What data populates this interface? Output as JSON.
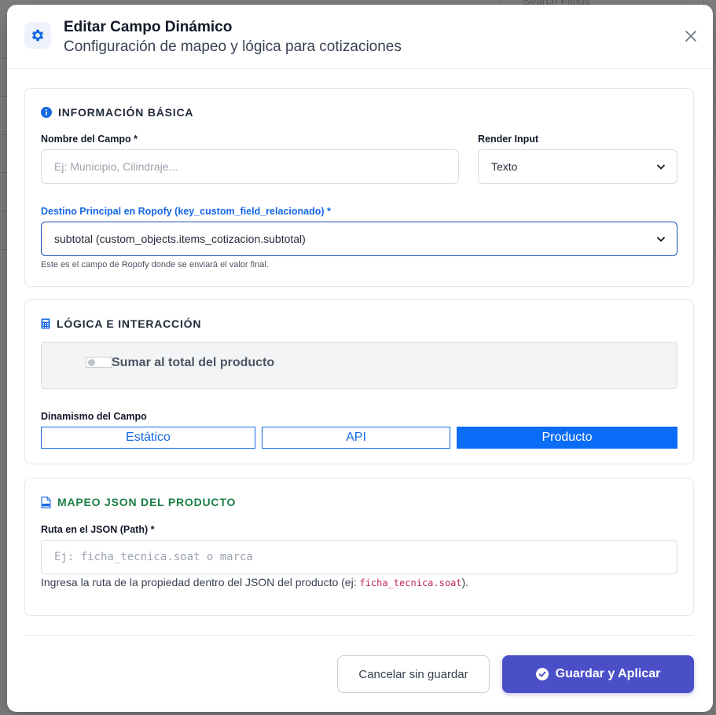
{
  "background": {
    "search_placeholder": "Search Fields"
  },
  "modal": {
    "title": "Editar Campo Dinámico",
    "subtitle": "Configuración de mapeo y lógica para cotizaciones",
    "header_icon": "gear-icon",
    "close_icon": "close-icon"
  },
  "basic": {
    "title": "INFORMACIÓN BÁSICA",
    "name_label": "Nombre del Campo *",
    "name_placeholder": "Ej: Municipio, Cilindraje...",
    "render_label": "Render Input",
    "render_value": "Texto",
    "target_label": "Destino Principal en Ropofy (key_custom_field_relacionado) *",
    "target_value": "subtotal (custom_objects.items_cotizacion.subtotal)",
    "target_help": "Este es el campo de Ropofy donde se enviará el valor final."
  },
  "logic": {
    "title": "LÓGICA E INTERACCIÓN",
    "toggle_label": "Sumar al total del producto",
    "toggle_on": false,
    "dynamism_label": "Dinamismo del Campo",
    "options": [
      "Estático",
      "API",
      "Producto"
    ],
    "selected": "Producto"
  },
  "mapping": {
    "title": "MAPEO JSON DEL PRODUCTO",
    "path_label": "Ruta en el JSON (Path) *",
    "path_placeholder": "Ej: ficha_tecnica.soat o marca",
    "help_prefix": "Ingresa la ruta de la propiedad dentro del JSON del producto (ej: ",
    "help_code": "ficha_tecnica.soat",
    "help_suffix": ")."
  },
  "footer": {
    "cancel_label": "Cancelar sin guardar",
    "save_label": "Guardar y Aplicar"
  },
  "colors": {
    "primary": "#4a4fc8",
    "accent_blue": "#0b6cf7",
    "mapping_green": "#1a7f45",
    "code_pink": "#c0275d"
  }
}
